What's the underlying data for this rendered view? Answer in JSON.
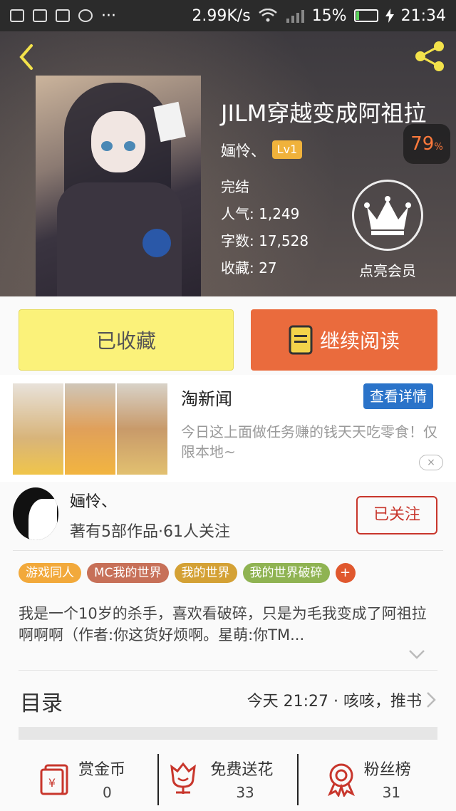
{
  "status_bar": {
    "speed": "2.99K/s",
    "battery_pct": "15%",
    "time": "21:34",
    "more": "···"
  },
  "book": {
    "title": "JILM穿越变成阿祖拉",
    "author": "婳怜、",
    "level": "Lv1",
    "rating": "79",
    "rating_unit": "%",
    "status": "完结",
    "popularity_label": "人气:",
    "popularity": "1,249",
    "words_label": "字数:",
    "words": "17,528",
    "favorites_label": "收藏:",
    "favorites": "27",
    "vip_label": "点亮会员"
  },
  "actions": {
    "favorited": "已收藏",
    "continue_reading": "继续阅读"
  },
  "ad": {
    "title": "淘新闻",
    "button": "查看详情",
    "description": "今日这上面做任务赚的钱天天吃零食！仅限本地~",
    "close": "×"
  },
  "author_box": {
    "name": "婳怜、",
    "subtitle": "著有5部作品·61人关注",
    "follow": "已关注"
  },
  "tags": [
    {
      "label": "游戏同人",
      "color": "#f2a93b"
    },
    {
      "label": "MC我的世界",
      "color": "#c77058"
    },
    {
      "label": "我的世界",
      "color": "#d4a135"
    },
    {
      "label": "我的世界破碎",
      "color": "#8fb352"
    }
  ],
  "tag_add": "+",
  "description": "我是一个10岁的杀手，喜欢看破碎，只是为毛我变成了阿祖拉啊啊啊（作者:你这货好烦啊。星萌:你TM...",
  "toc": {
    "label": "目录",
    "latest": "今天 21:27 · 咳咳，推书"
  },
  "bottom": [
    {
      "label": "赏金币",
      "value": "0",
      "icon": "coin-envelope-icon"
    },
    {
      "label": "免费送花",
      "value": "33",
      "icon": "flower-icon"
    },
    {
      "label": "粉丝榜",
      "value": "31",
      "icon": "medal-icon"
    }
  ],
  "colors": {
    "accent": "#ea6b3d",
    "favorite_bg": "#fbf27a",
    "follow": "#c8362c",
    "ad_button": "#2a73c9",
    "rating": "#ff7a3c"
  }
}
